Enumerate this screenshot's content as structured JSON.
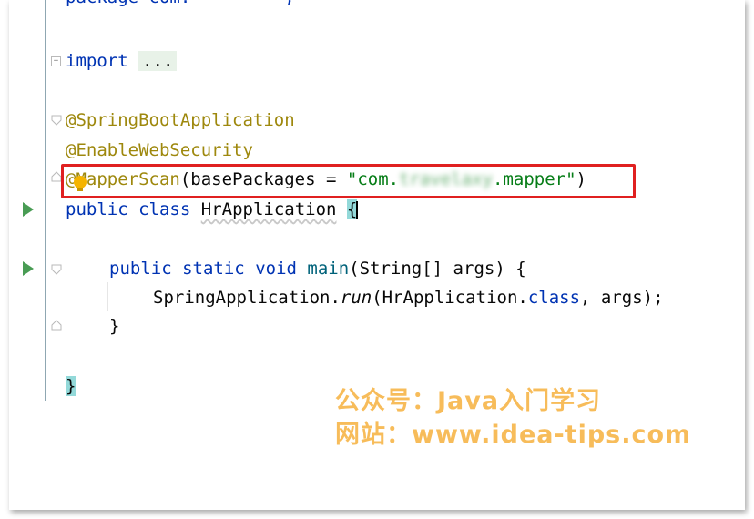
{
  "editor": {
    "top_line_partial": "package com.         ;",
    "import_keyword": "import",
    "import_folded": "...",
    "annotations": [
      "@SpringBootApplication",
      "@EnableWebSecurity"
    ],
    "mapper_scan": {
      "annotation": "@MapperScan",
      "open": "(basePackages = ",
      "string_prefix": "\"com.",
      "string_blurred": "travelaxy",
      "string_suffix": ".mapper\"",
      "close": ")"
    },
    "class_decl": {
      "kw_public": "public",
      "kw_class": "class",
      "class_name": "HrApplication",
      "brace": "{"
    },
    "main_decl": {
      "kw_public": "public",
      "kw_static": "static",
      "kw_void": "void",
      "method": "main",
      "params": "(String[] args) {"
    },
    "run_stmt": {
      "receiver": "SpringApplication.",
      "method": "run",
      "args_start": "(HrApplication.",
      "kw_class": "class",
      "args_end": ", args);"
    },
    "method_close": "}",
    "class_close": "}"
  },
  "watermark": {
    "line1": "公众号：Java入门学习",
    "line2": "网站：www.idea-tips.com"
  },
  "colors": {
    "keyword": "#0033b3",
    "annotation": "#9e880d",
    "string": "#067d17",
    "highlight_box": "#e02020",
    "run_icon": "#499c54",
    "watermark": "#f5a623"
  },
  "icons": [
    "fold-plus-icon",
    "fold-down-icon",
    "fold-up-icon",
    "run-gutter-icon",
    "intention-bulb-icon"
  ]
}
